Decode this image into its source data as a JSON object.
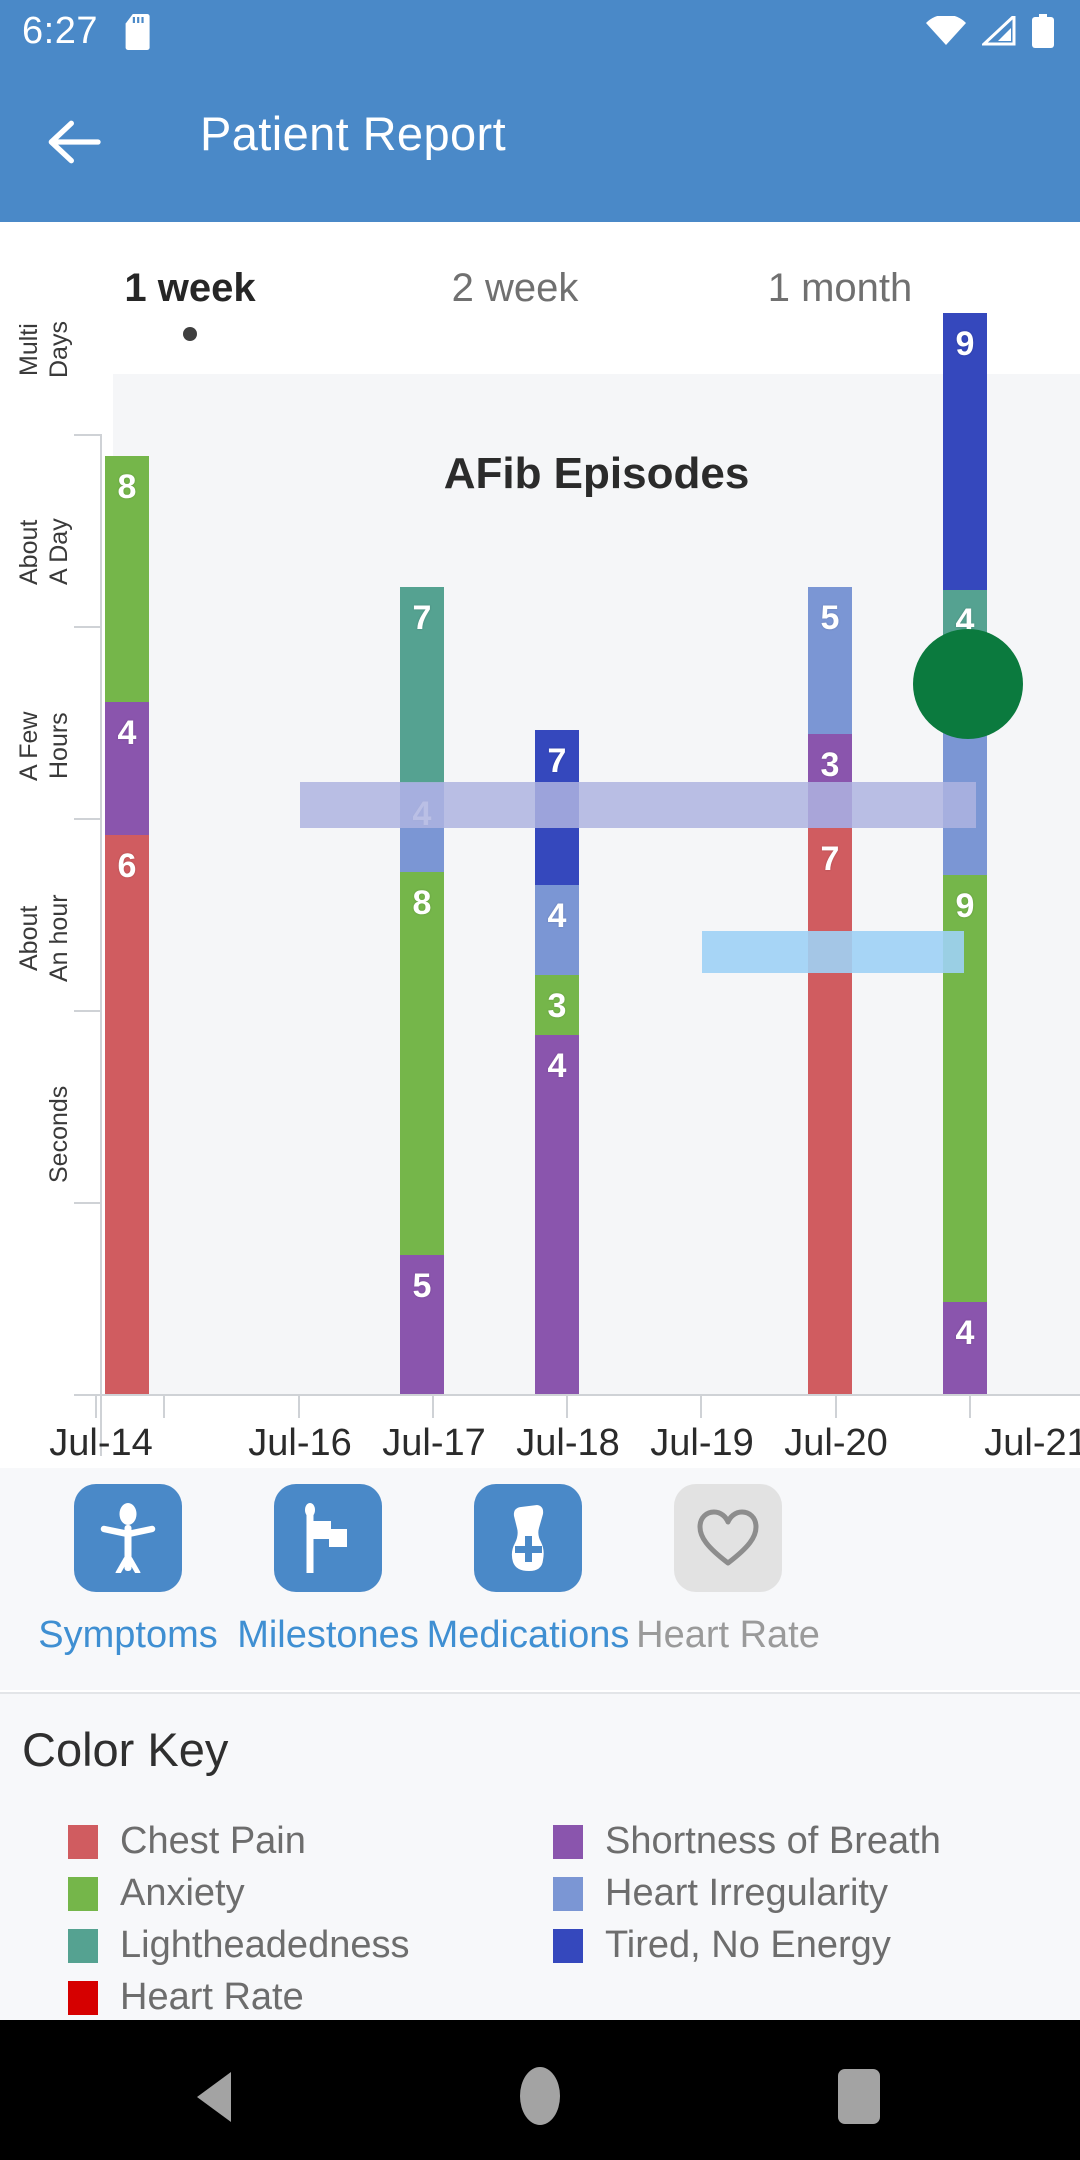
{
  "status_bar": {
    "time": "6:27",
    "icons": [
      "sd-card-icon",
      "wifi-icon",
      "cellular-signal-icon",
      "battery-icon"
    ]
  },
  "app_bar": {
    "title": "Patient Report",
    "back_icon": "arrow-left-icon"
  },
  "tabs": [
    {
      "label": "1 week",
      "active": true
    },
    {
      "label": "2 week",
      "active": false
    },
    {
      "label": "1 month",
      "active": false
    }
  ],
  "actions": [
    {
      "label": "Symptoms",
      "icon": "person-icon",
      "active": true
    },
    {
      "label": "Milestones",
      "icon": "flag-icon",
      "active": true
    },
    {
      "label": "Medications",
      "icon": "medicine-bottle-icon",
      "active": true
    },
    {
      "label": "Heart Rate",
      "icon": "heart-outline-icon",
      "active": false
    }
  ],
  "color_key": {
    "title": "Color Key",
    "left": [
      {
        "label": "Chest Pain",
        "color": "#d05c60"
      },
      {
        "label": "Anxiety",
        "color": "#75b64a"
      },
      {
        "label": "Lightheadedness",
        "color": "#55a291"
      },
      {
        "label": "Heart Rate",
        "color": "#d60000"
      }
    ],
    "right": [
      {
        "label": "Shortness of Breath",
        "color": "#8a55ad"
      },
      {
        "label": "Heart Irregularity",
        "color": "#7b96d4"
      },
      {
        "label": "Tired, No Energy",
        "color": "#3548bd"
      }
    ]
  },
  "theme": {
    "primary": "#4a89c8",
    "accent_link": "#3f8fd2",
    "plot_bg": "#f5f6f8",
    "panel_bg": "#f7f8fa"
  },
  "chart_data": {
    "type": "bar",
    "title": "AFib Episodes",
    "xlabel": "",
    "ylabel": "",
    "stacked": true,
    "grid": false,
    "legend_position": "below-chart",
    "categories": [
      "Jul-14",
      "Jul-16",
      "Jul-17",
      "Jul-18",
      "Jul-19",
      "Jul-20",
      "Jul-21"
    ],
    "y_tick_labels": [
      "Multi\nDays",
      "About\nA Day",
      "A Few\nHours",
      "About\nAn hour",
      "Seconds"
    ],
    "series": [
      {
        "name": "Chest Pain",
        "color": "#d05c60"
      },
      {
        "name": "Anxiety",
        "color": "#75b64a"
      },
      {
        "name": "Lightheadedness",
        "color": "#55a291"
      },
      {
        "name": "Shortness of Breath",
        "color": "#8a55ad"
      },
      {
        "name": "Heart Irregularity",
        "color": "#7b96d4"
      },
      {
        "name": "Tired, No Energy",
        "color": "#3548bd"
      }
    ],
    "bars": [
      {
        "category": "Jul-14",
        "segments": [
          {
            "series": "Anxiety",
            "value": 8,
            "color": "#75b64a"
          },
          {
            "series": "Shortness of Breath",
            "value": 4,
            "color": "#8a55ad"
          },
          {
            "series": "Chest Pain",
            "value": 6,
            "color": "#d05c60"
          }
        ]
      },
      {
        "category": "Jul-17",
        "segments": [
          {
            "series": "Lightheadedness",
            "value": 7,
            "color": "#55a291"
          },
          {
            "series": "Heart Irregularity",
            "value": 4,
            "color": "#7b96d4"
          },
          {
            "series": "Anxiety",
            "value": 8,
            "color": "#75b64a"
          },
          {
            "series": "Shortness of Breath",
            "value": 5,
            "color": "#8a55ad"
          }
        ]
      },
      {
        "category": "Jul-18",
        "segments": [
          {
            "series": "Tired, No Energy",
            "value": 7,
            "color": "#3548bd"
          },
          {
            "series": "Heart Irregularity",
            "value": 4,
            "color": "#7b96d4"
          },
          {
            "series": "Anxiety",
            "value": 3,
            "color": "#75b64a"
          },
          {
            "series": "Shortness of Breath",
            "value": 4,
            "color": "#8a55ad"
          }
        ]
      },
      {
        "category": "Jul-20",
        "segments": [
          {
            "series": "Heart Irregularity",
            "value": 5,
            "color": "#7b96d4"
          },
          {
            "series": "Shortness of Breath",
            "value": 3,
            "color": "#8a55ad"
          },
          {
            "series": "Chest Pain",
            "value": 7,
            "color": "#d05c60"
          }
        ]
      },
      {
        "category": "Jul-21",
        "segments": [
          {
            "series": "Tired, No Energy",
            "value": 9,
            "color": "#3548bd"
          },
          {
            "series": "Lightheadedness",
            "value": 4,
            "color": "#55a291"
          },
          {
            "series": "Heart Irregularity",
            "value": 5,
            "color": "#7b96d4"
          },
          {
            "series": "Anxiety",
            "value": 9,
            "color": "#75b64a"
          },
          {
            "series": "Shortness of Breath",
            "value": 4,
            "color": "#8a55ad"
          }
        ]
      }
    ],
    "overlays": [
      {
        "name": "milestone-band",
        "color": "#aeb4e0",
        "opacity": 0.85
      },
      {
        "name": "medication-band",
        "color": "#9ed2f5",
        "opacity": 0.9
      }
    ],
    "annotations": [
      {
        "name": "heart-rate-marker",
        "color": "#0b7a3e",
        "shape": "circle"
      }
    ]
  }
}
